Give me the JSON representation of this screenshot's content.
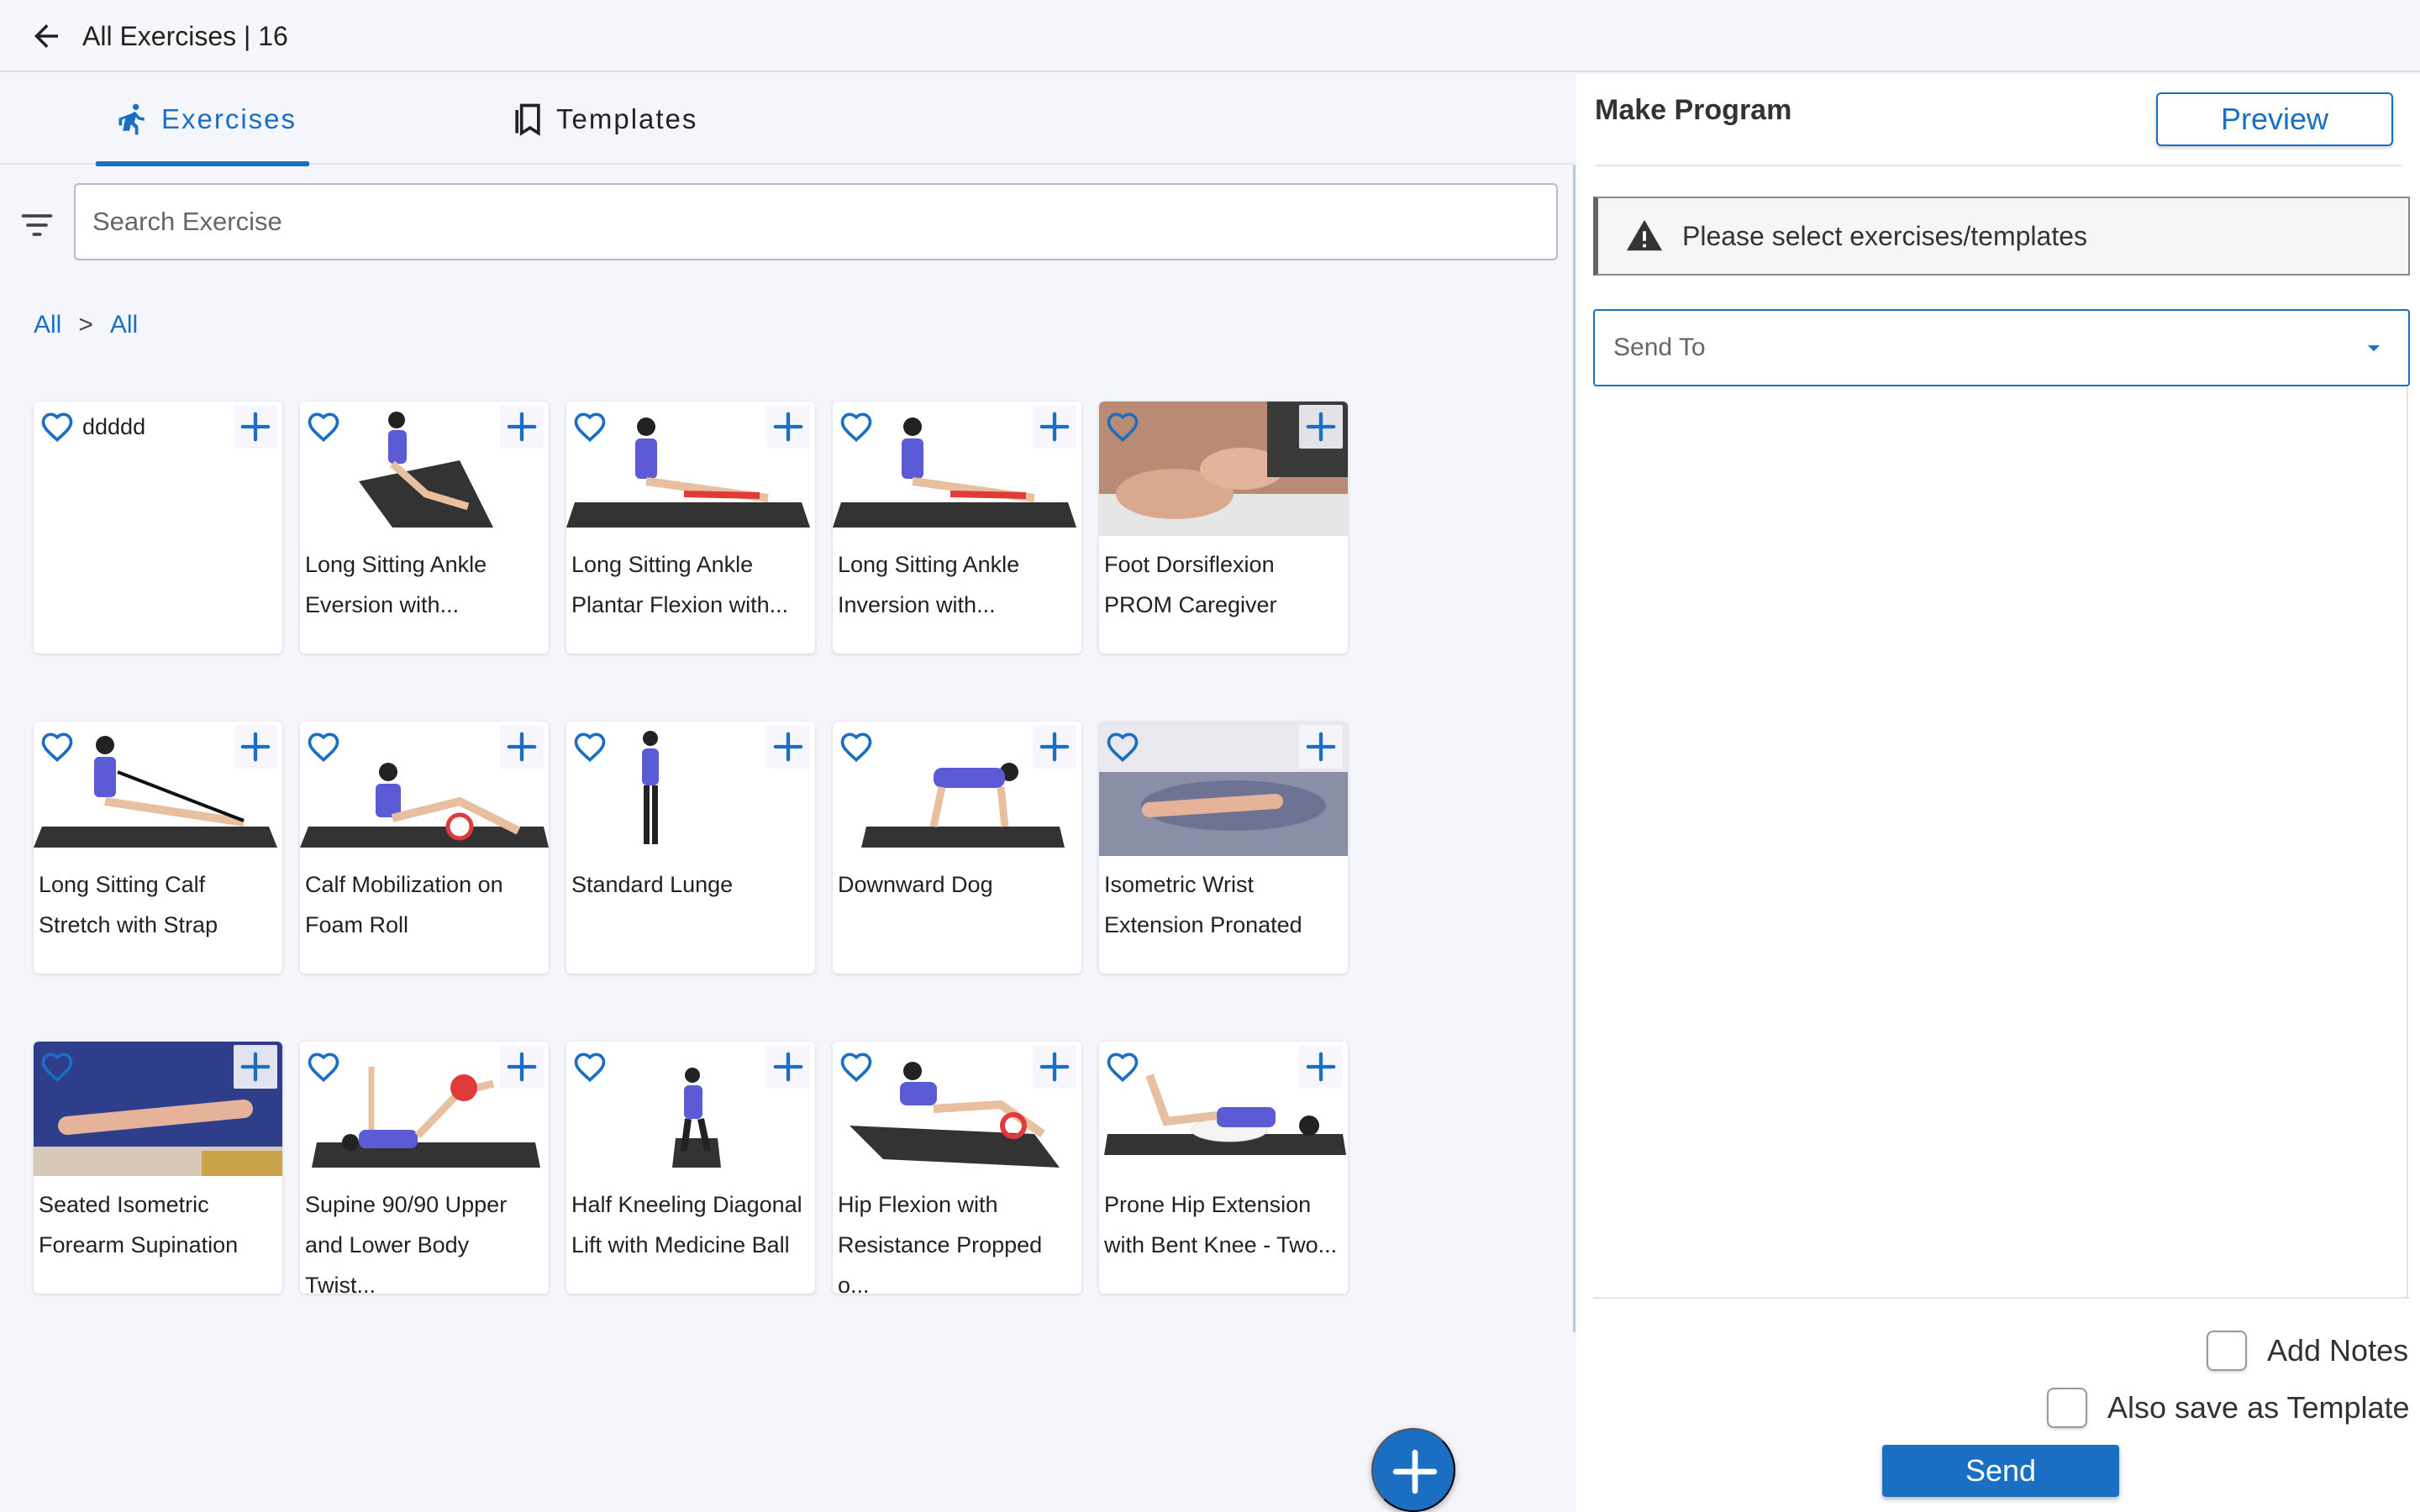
{
  "header": {
    "title": "All Exercises | 16"
  },
  "tabs": [
    {
      "label": "Exercises",
      "active": true
    },
    {
      "label": "Templates",
      "active": false
    }
  ],
  "search": {
    "placeholder": "Search Exercise"
  },
  "breadcrumb": {
    "items": [
      "All",
      "All"
    ],
    "separator": ">"
  },
  "exercises": [
    {
      "name": "ddddd",
      "thumb": "blank"
    },
    {
      "name": "Long Sitting Ankle Eversion with...",
      "thumb": "person-seated-diagonal-mat"
    },
    {
      "name": "Long Sitting Ankle Plantar Flexion with...",
      "thumb": "person-seated-band-mat"
    },
    {
      "name": "Long Sitting Ankle Inversion with...",
      "thumb": "person-seated-band-mat"
    },
    {
      "name": "Foot Dorsiflexion PROM Caregiver",
      "thumb": "hands-foot-photo"
    },
    {
      "name": "Long Sitting Calf Stretch with Strap",
      "thumb": "person-seated-strap-mat"
    },
    {
      "name": "Calf Mobilization on Foam Roll",
      "thumb": "person-foam-roll-mat"
    },
    {
      "name": "Standard Lunge",
      "thumb": "person-standing"
    },
    {
      "name": "Downward Dog",
      "thumb": "person-quadruped-mat"
    },
    {
      "name": "Isometric Wrist Extension Pronated",
      "thumb": "hand-on-table-photo"
    },
    {
      "name": "Seated Isometric Forearm Supination",
      "thumb": "arm-on-table-photo"
    },
    {
      "name": "Supine 90/90 Upper and Lower Body Twist...",
      "thumb": "person-supine-ball-mat"
    },
    {
      "name": "Half Kneeling Diagonal Lift with Medicine Ball",
      "thumb": "person-kneeling-mat"
    },
    {
      "name": "Hip Flexion with Resistance Propped o...",
      "thumb": "person-propped-band-mat"
    },
    {
      "name": "Prone Hip Extension with Bent Knee - Two...",
      "thumb": "person-prone-pillow"
    }
  ],
  "right_panel": {
    "title": "Make Program",
    "preview_label": "Preview",
    "alert_text": "Please select exercises/templates",
    "send_to_placeholder": "Send To",
    "add_notes_label": "Add Notes",
    "save_template_label": "Also save as Template",
    "send_label": "Send"
  },
  "colors": {
    "accent": "#1a6fc2",
    "background": "#f5f5fc",
    "card": "#ffffff"
  },
  "icons": {
    "back": "arrow-left-icon",
    "exercises_tab": "running-person-icon",
    "templates_tab": "bookmark-stack-icon",
    "filter": "filter-lines-icon",
    "favorite": "heart-outline-icon",
    "add": "plus-icon",
    "warning": "warning-triangle-icon",
    "dropdown": "caret-down-icon"
  }
}
